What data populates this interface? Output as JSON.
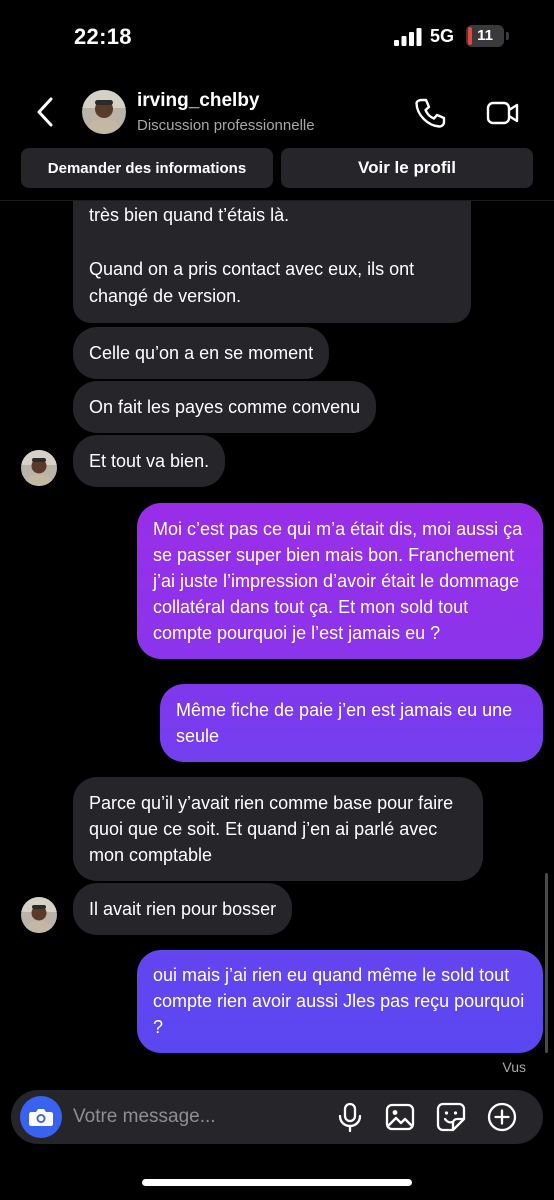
{
  "status_bar": {
    "time": "22:18",
    "network": "5G",
    "battery": "11",
    "battery_level": 0.11
  },
  "header": {
    "username": "irving_chelby",
    "subtitle": "Discussion professionnelle",
    "info_button": "Demander des informations",
    "profile_button": "Voir le profil"
  },
  "messages": [
    {
      "from": "them",
      "text": "très bien quand t’étais là.\n\nQuand on a pris contact avec eux, ils ont changé de version."
    },
    {
      "from": "them",
      "text": "Celle qu’on a en se moment"
    },
    {
      "from": "them",
      "text": "On fait les payes comme convenu"
    },
    {
      "from": "them",
      "text": "Et tout va bien."
    },
    {
      "from": "me",
      "text": "Moi c’est pas ce qui m’a était dis, moi aussi ça se passer super bien mais bon. Franchement j’ai juste l’impression d’avoir était le dommage collatéral dans tout ça. Et mon sold tout compte pourquoi je l’est jamais eu ?"
    },
    {
      "from": "me",
      "text": "Même fiche de paie j’en est jamais eu une seule"
    },
    {
      "from": "them",
      "text": "Parce qu’il y’avait rien comme base pour faire quoi que ce soit. Et quand j’en ai parlé avec mon comptable"
    },
    {
      "from": "them",
      "text": "Il avait rien pour bosser"
    },
    {
      "from": "me",
      "text": "oui mais j’ai rien eu quand même le sold tout compte rien avoir aussi Jles pas reçu pourquoi ?"
    }
  ],
  "seen_label": "Vus",
  "composer": {
    "placeholder": "Votre message..."
  },
  "icons": {
    "back": "chevron-left-icon",
    "call": "phone-icon",
    "video": "video-camera-icon",
    "camera": "camera-icon",
    "mic": "microphone-icon",
    "gallery": "image-icon",
    "sticker": "sticker-icon",
    "add": "plus-circle-icon"
  },
  "colors": {
    "background": "#000000",
    "incoming_bubble": "#26262a",
    "outgoing_top": "#9a2ee8",
    "outgoing_bottom": "#5a47f0",
    "camera_button": "#3a62f0",
    "battery_low": "#e9453a"
  }
}
